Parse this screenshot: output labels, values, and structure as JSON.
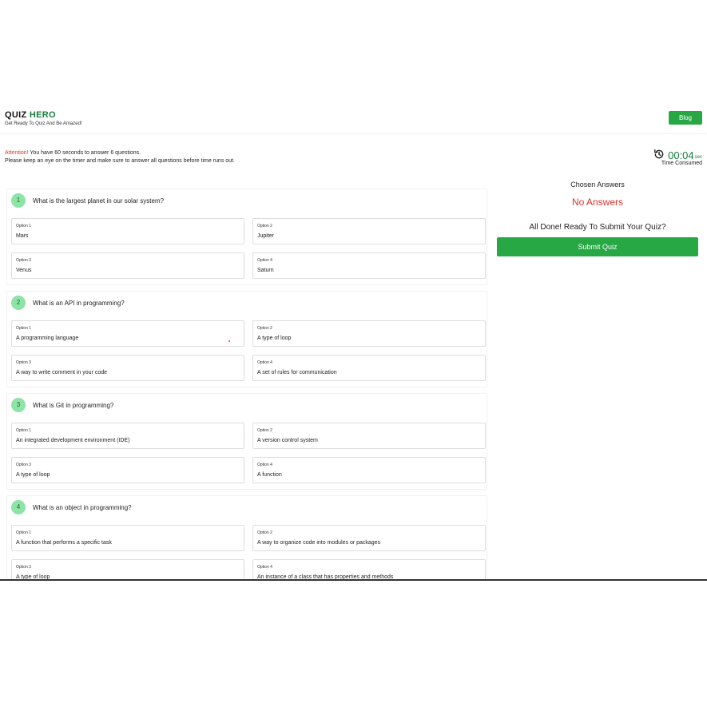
{
  "header": {
    "brand_prefix": "QUIZ",
    "brand_accent": "HERO",
    "tagline": "Get Ready To Quiz And Be Amazed!",
    "blog_label": "Blog"
  },
  "notice": {
    "warning_word": "Attention!",
    "line1": " You have 60 seconds to answer 6 questions.",
    "line2": "Please keep an eye on the timer and make sure to answer all questions before time runs out."
  },
  "timer": {
    "icon": "history-icon",
    "value": "00:04",
    "unit": "sec",
    "label": "Time Consumed"
  },
  "questions": [
    {
      "number": "1",
      "text": "What is the largest planet in our solar system?",
      "options": [
        {
          "label": "Option 1",
          "text": "Mars"
        },
        {
          "label": "Option 2",
          "text": "Jupiter"
        },
        {
          "label": "Option 3",
          "text": "Venus"
        },
        {
          "label": "Option 4",
          "text": "Saturn"
        }
      ]
    },
    {
      "number": "2",
      "text": "What is an API in programming?",
      "options": [
        {
          "label": "Option 1",
          "text": "A programming language"
        },
        {
          "label": "Option 2",
          "text": "A type of loop"
        },
        {
          "label": "Option 3",
          "text": "A way to write comment in your code"
        },
        {
          "label": "Option 4",
          "text": "A set of rules for communication"
        }
      ]
    },
    {
      "number": "3",
      "text": "What is Git in programming?",
      "options": [
        {
          "label": "Option 1",
          "text": "An integrated development environment (IDE)"
        },
        {
          "label": "Option 2",
          "text": "A version control system"
        },
        {
          "label": "Option 3",
          "text": "A type of loop"
        },
        {
          "label": "Option 4",
          "text": "A function"
        }
      ]
    },
    {
      "number": "4",
      "text": "What is an object in programming?",
      "options": [
        {
          "label": "Option 1",
          "text": "A function that performs a specific task"
        },
        {
          "label": "Option 2",
          "text": "A way to organize code into modules or packages"
        },
        {
          "label": "Option 3",
          "text": "A type of loop"
        },
        {
          "label": "Option 4",
          "text": "An instance of a class that has properties and methods"
        }
      ]
    }
  ],
  "sidebar": {
    "title": "Chosen Answers",
    "empty_text": "No Answers",
    "ready_text": "All Done! Ready To Submit Your Quiz?",
    "submit_label": "Submit Quiz"
  },
  "colors": {
    "accent": "#28a745",
    "brand_green": "#16803c",
    "warning": "#d9342b",
    "badge": "#8ee3a6"
  }
}
